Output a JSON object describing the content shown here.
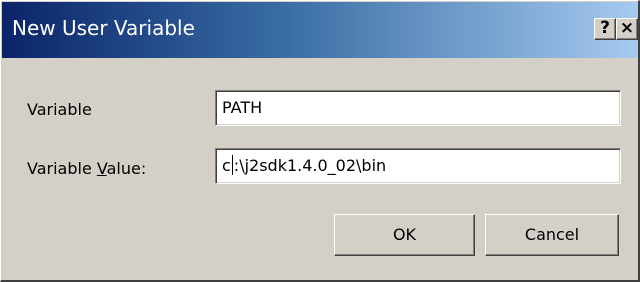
{
  "window": {
    "title": "New User Variable",
    "help_button": "?",
    "close_button": "×"
  },
  "form": {
    "variable_label": "Variable",
    "variable_value": "PATH",
    "value_label_prefix": "Variable ",
    "value_label_accel": "V",
    "value_label_suffix": "alue:",
    "value_before_caret": "c",
    "value_after_caret": ":\\j2sdk1.4.0_02\\bin"
  },
  "buttons": {
    "ok": "OK",
    "cancel": "Cancel"
  }
}
